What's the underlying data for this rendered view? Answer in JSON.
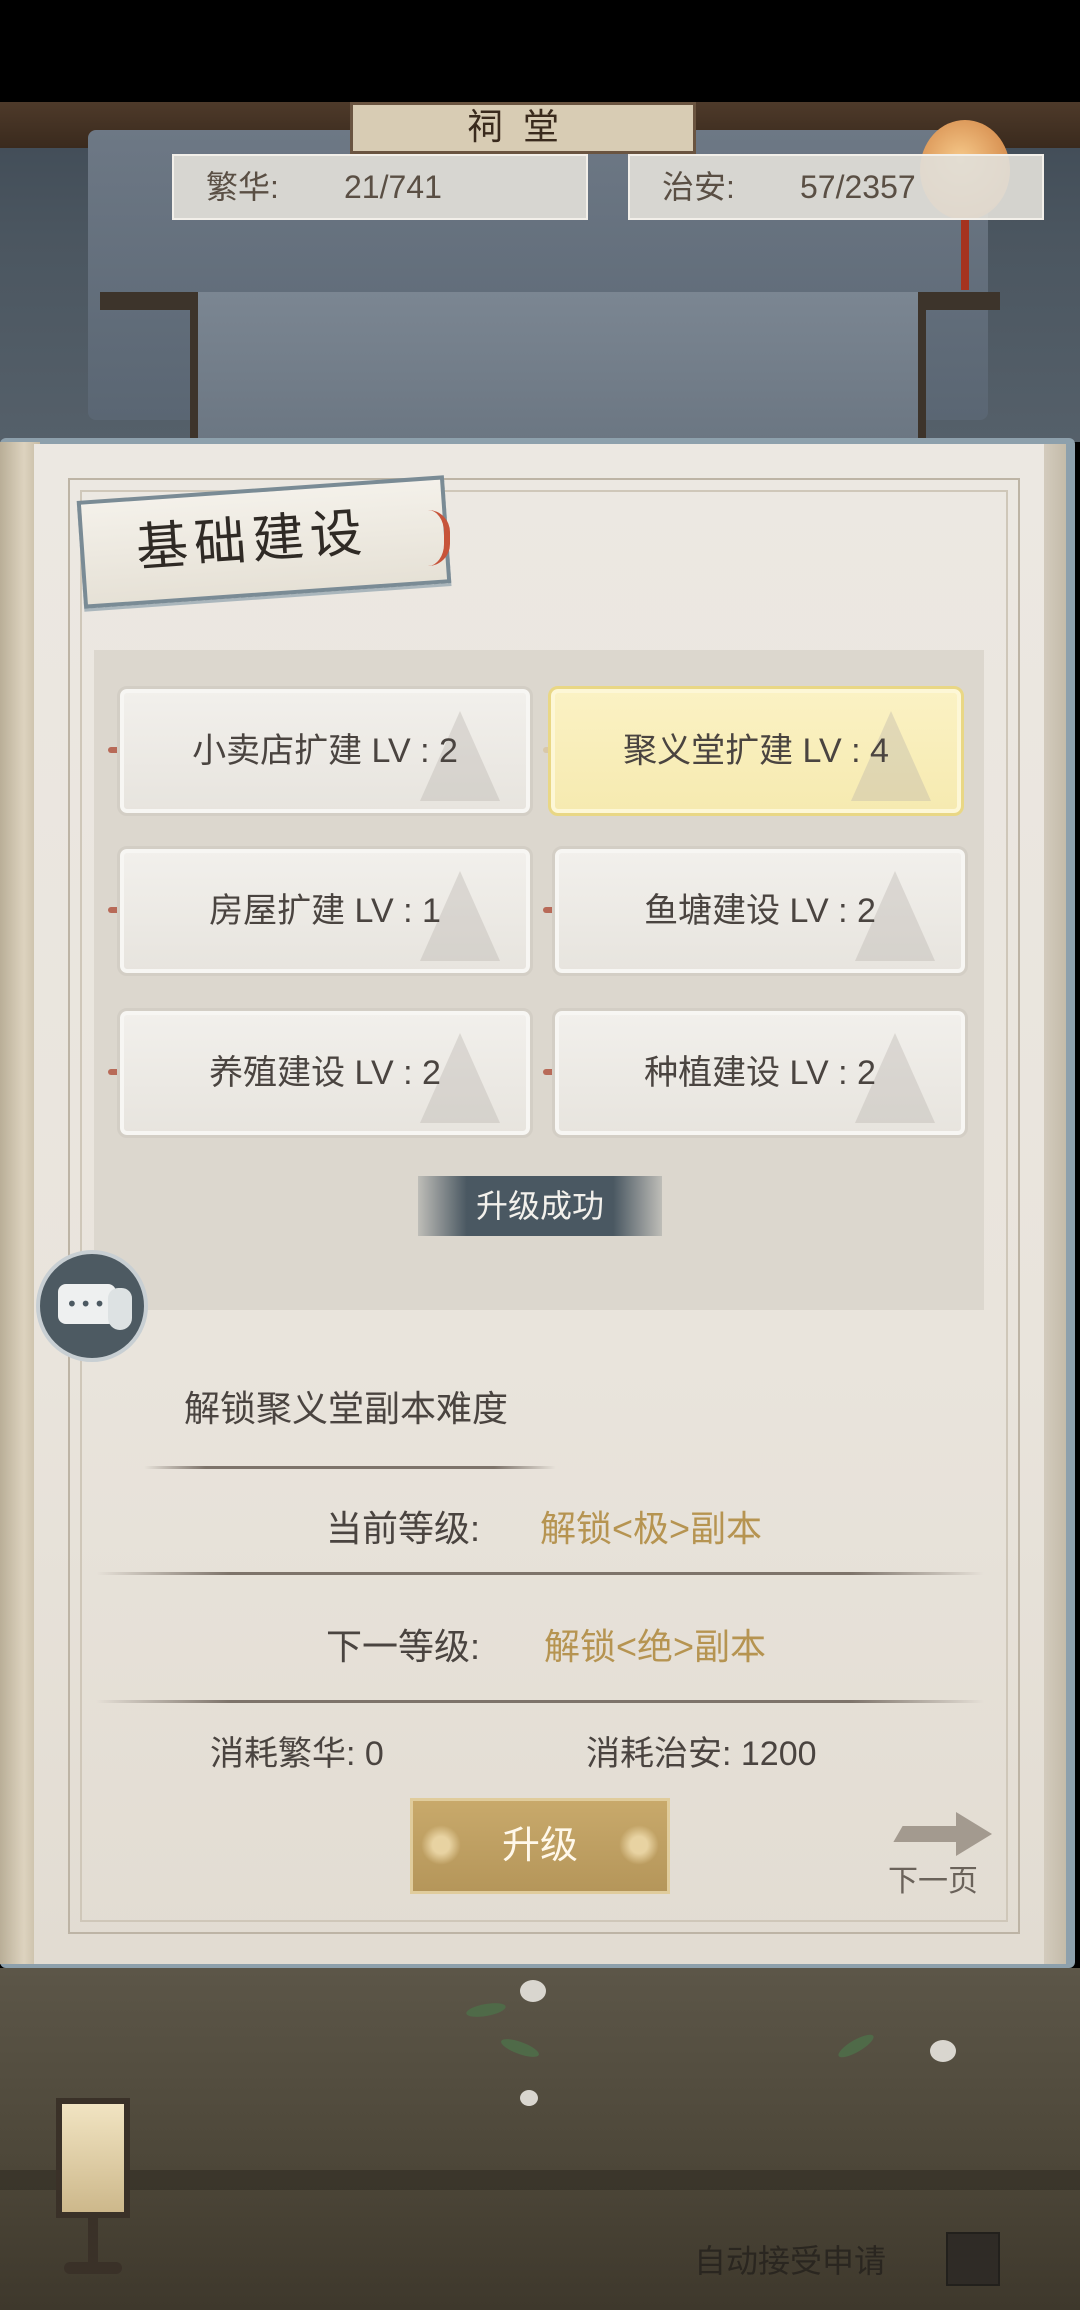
{
  "background": {
    "hall_sign": "祠堂"
  },
  "stats": {
    "prosperity": {
      "label": "繁华:",
      "value": "21/741"
    },
    "security": {
      "label": "治安:",
      "value": "57/2357"
    }
  },
  "page": {
    "title": "基础建设"
  },
  "buildings": [
    {
      "label": "小卖店扩建 LV : 2",
      "active": false
    },
    {
      "label": "聚义堂扩建 LV : 4",
      "active": true
    },
    {
      "label": "房屋扩建 LV : 1",
      "active": false
    },
    {
      "label": "鱼塘建设 LV : 2",
      "active": false
    },
    {
      "label": "养殖建设 LV : 2",
      "active": false
    },
    {
      "label": "种植建设 LV : 2",
      "active": false
    }
  ],
  "toast": "升级成功",
  "detail": {
    "title": "解锁聚义堂副本难度",
    "current_label": "当前等级:",
    "current_value": "解锁<极>副本",
    "next_label": "下一等级:",
    "next_value": "解锁<绝>副本",
    "cost_prosperity": "消耗繁华:  0",
    "cost_security": "消耗治安:  1200"
  },
  "actions": {
    "upgrade": "升级",
    "next_page": "下一页"
  },
  "footer": {
    "auto_accept": "自动接受申请"
  },
  "colors": {
    "accent_gold": "#b69451",
    "active_tile": "#f6eab0",
    "toast_bg": "#4a5862"
  }
}
